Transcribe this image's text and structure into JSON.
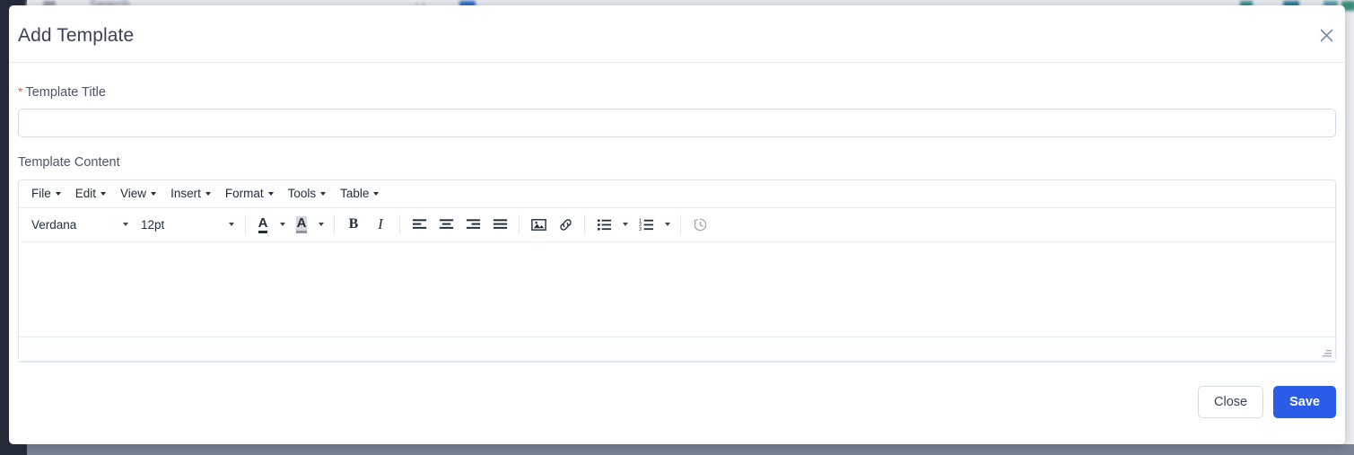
{
  "backdrop": {
    "search_placeholder": "Search",
    "hamburger_icon": "hamburger-menu-icon",
    "sidebar_color": "#252b3a"
  },
  "modal": {
    "title": "Add Template",
    "close_icon": "close-icon",
    "fields": {
      "title": {
        "label": "Template Title",
        "required_marker": "*",
        "value": "",
        "placeholder": ""
      },
      "content": {
        "label": "Template Content",
        "value": ""
      }
    },
    "editor": {
      "menubar": [
        {
          "label": "File"
        },
        {
          "label": "Edit"
        },
        {
          "label": "View"
        },
        {
          "label": "Insert"
        },
        {
          "label": "Format"
        },
        {
          "label": "Tools"
        },
        {
          "label": "Table"
        }
      ],
      "toolbar": {
        "font_family": "Verdana",
        "font_size": "12pt",
        "text_color_label": "A",
        "background_color_label": "A",
        "bold_label": "B",
        "italic_label": "I",
        "icons": [
          "align-left-icon",
          "align-center-icon",
          "align-right-icon",
          "align-justify-icon",
          "insert-image-icon",
          "insert-link-icon",
          "bullet-list-icon",
          "numbered-list-icon",
          "restore-draft-icon"
        ]
      },
      "statusbar_text": ""
    },
    "footer": {
      "close_label": "Close",
      "save_label": "Save"
    }
  },
  "colors": {
    "accent_blue": "#2b5ce8",
    "required_red": "#e8603c",
    "title_text": "#3c4257",
    "label_text": "#4b5468"
  }
}
